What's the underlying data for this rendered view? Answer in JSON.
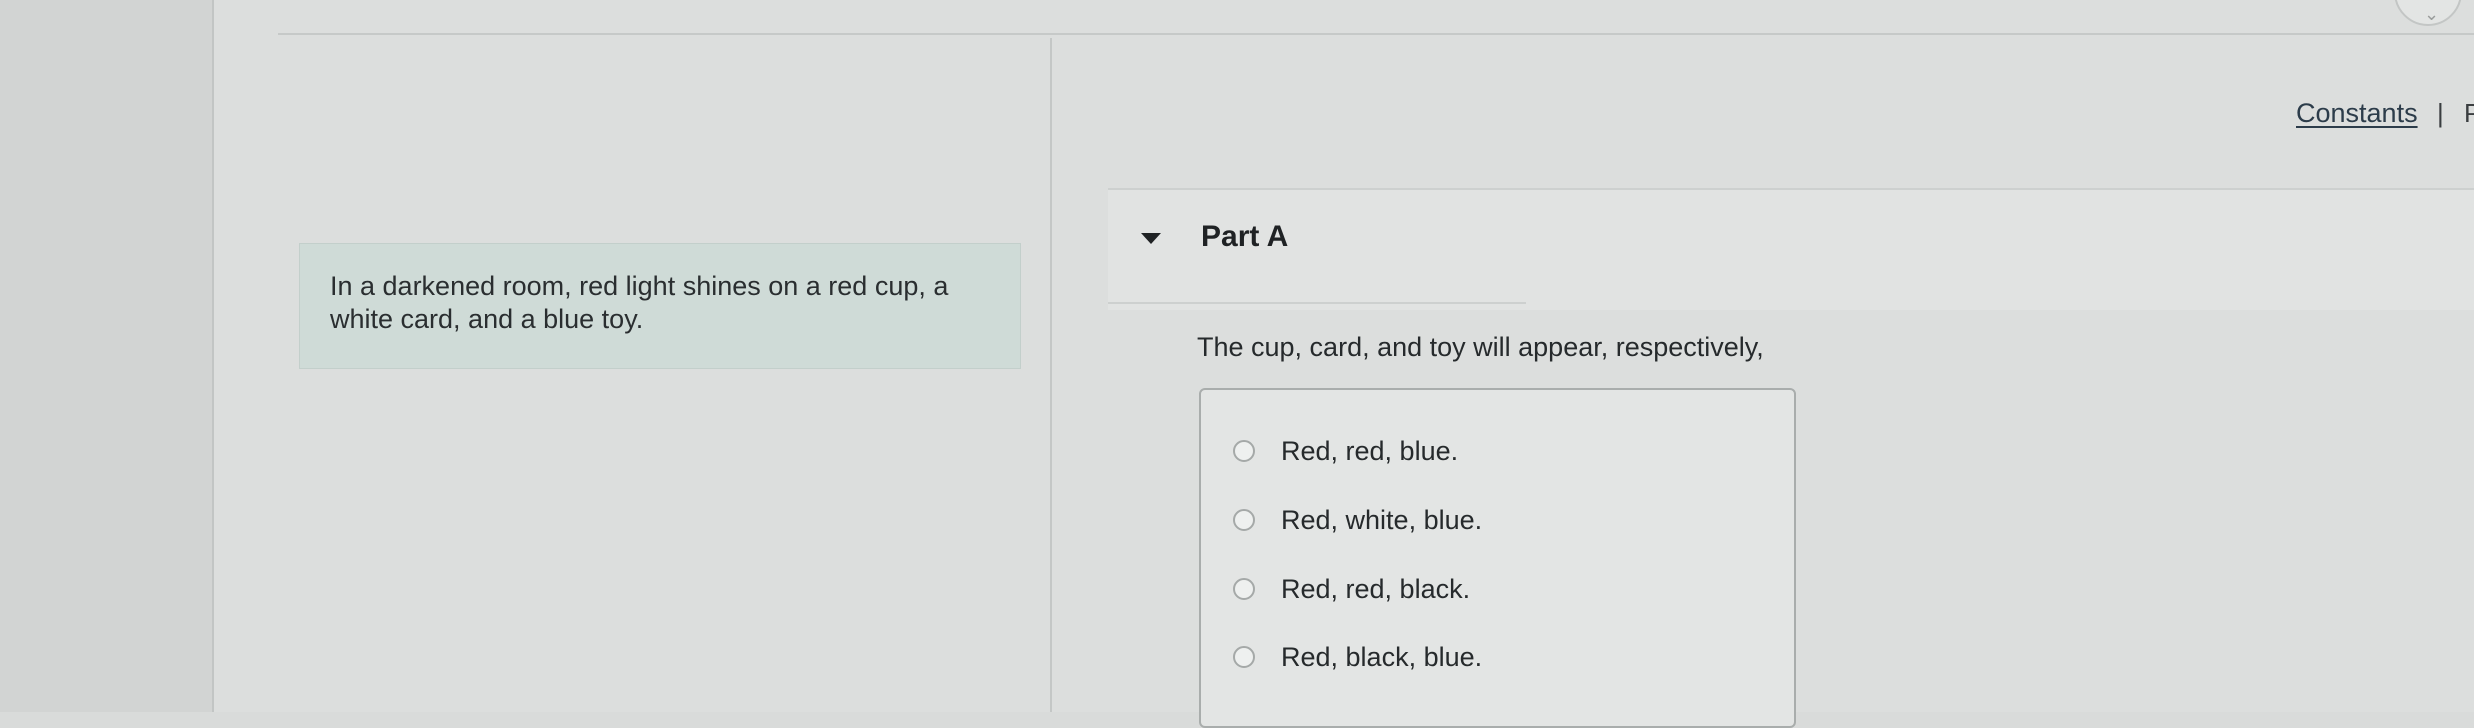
{
  "header": {
    "constants_link": "Constants",
    "separator": "|",
    "next_link": "P"
  },
  "intro": {
    "text": "In a darkened room, red light shines on a red cup, a white card, and a blue toy."
  },
  "part": {
    "title": "Part A",
    "question": "The cup, card, and toy will appear, respectively,",
    "options": [
      "Red, red, blue.",
      "Red, white, blue.",
      "Red, red, black.",
      "Red, black, blue."
    ]
  },
  "colors": {
    "intro_background": "#cfdbd7",
    "page_background": "#dcdedd",
    "link": "#2c3c4a"
  },
  "icons": {
    "collapse": "caret-down-icon",
    "option_radio": "radio-button-icon"
  }
}
